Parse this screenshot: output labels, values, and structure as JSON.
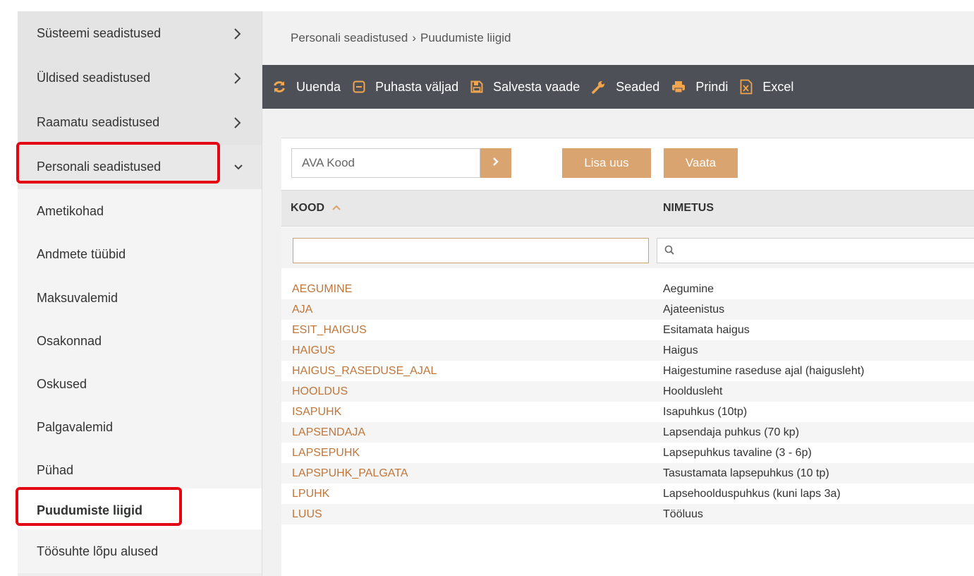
{
  "sidebar": {
    "groups": [
      {
        "label": "Süsteemi seadistused"
      },
      {
        "label": "Üldised seadistused"
      },
      {
        "label": "Raamatu seadistused"
      },
      {
        "label": "Personali seadistused"
      }
    ],
    "submenu": [
      {
        "label": "Ametikohad"
      },
      {
        "label": "Andmete tüübid"
      },
      {
        "label": "Maksuvalemid"
      },
      {
        "label": "Osakonnad"
      },
      {
        "label": "Oskused"
      },
      {
        "label": "Palgavalemid"
      },
      {
        "label": "Pühad"
      },
      {
        "label": "Puudumiste liigid"
      },
      {
        "label": "Töösuhte lõpu alused"
      }
    ]
  },
  "breadcrumb": {
    "parent": "Personali seadistused",
    "separator": "›",
    "current": "Puudumiste liigid"
  },
  "toolbar": {
    "refresh": "Uuenda",
    "clear": "Puhasta väljad",
    "save_view": "Salvesta vaade",
    "settings": "Seaded",
    "print": "Prindi",
    "excel": "Excel"
  },
  "search": {
    "placeholder": "AVA Kood"
  },
  "buttons": {
    "add_new": "Lisa uus",
    "view": "Vaata"
  },
  "table": {
    "headers": {
      "kood": "KOOD",
      "nimetus": "NIMETUS"
    },
    "rows": [
      {
        "kood": "AEGUMINE",
        "nimetus": "Aegumine"
      },
      {
        "kood": "AJA",
        "nimetus": "Ajateenistus"
      },
      {
        "kood": "ESIT_HAIGUS",
        "nimetus": "Esitamata haigus"
      },
      {
        "kood": "HAIGUS",
        "nimetus": "Haigus"
      },
      {
        "kood": "HAIGUS_RASEDUSE_AJAL",
        "nimetus": "Haigestumine raseduse ajal (haigusleht)"
      },
      {
        "kood": "HOOLDUS",
        "nimetus": "Hooldusleht"
      },
      {
        "kood": "ISAPUHK",
        "nimetus": "Isapuhkus (10tp)"
      },
      {
        "kood": "LAPSENDAJA",
        "nimetus": "Lapsendaja puhkus (70 kp)"
      },
      {
        "kood": "LAPSEPUHK",
        "nimetus": "Lapsepuhkus tavaline (3 - 6p)"
      },
      {
        "kood": "LAPSPUHK_PALGATA",
        "nimetus": "Tasustamata lapsepuhkus (10 tp)"
      },
      {
        "kood": "LPUHK",
        "nimetus": "Lapsehoolduspuhkus (kuni laps 3a)"
      },
      {
        "kood": "LUUS",
        "nimetus": "Tööluus"
      }
    ]
  },
  "colors": {
    "accent": "#d9a46f",
    "link": "#c0763a",
    "toolbar_bg": "#4d5157",
    "highlight": "#e30613"
  }
}
